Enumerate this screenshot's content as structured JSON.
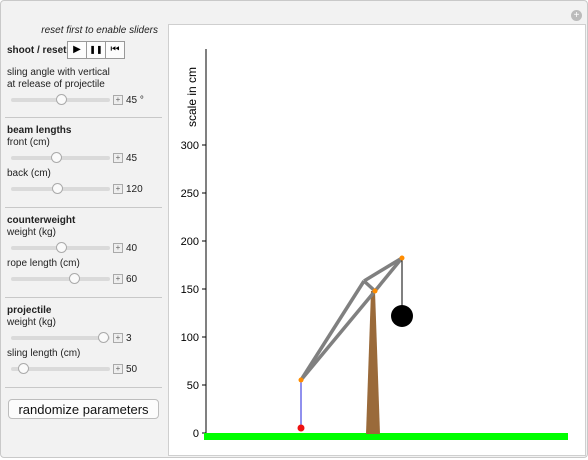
{
  "hint": "reset first to enable sliders",
  "controls": {
    "label": "shoot / reset",
    "play_glyph": "▶",
    "pause_glyph": "❚❚",
    "reset_glyph": "⏮"
  },
  "sling_angle": {
    "label_line1": "sling angle with vertical",
    "label_line2": "at release of projectile",
    "value": "45 °",
    "fraction": 0.5
  },
  "beam": {
    "heading": "beam lengths",
    "front": {
      "label": "front (cm)",
      "value": "45",
      "fraction": 0.45
    },
    "back": {
      "label": "back (cm)",
      "value": "120",
      "fraction": 0.46
    }
  },
  "counterweight": {
    "heading": "counterweight",
    "weight": {
      "label": "weight (kg)",
      "value": "40",
      "fraction": 0.5
    },
    "rope": {
      "label": "rope length (cm)",
      "value": "60",
      "fraction": 0.64
    }
  },
  "projectile": {
    "heading": "projectile",
    "weight": {
      "label": "weight (kg)",
      "value": "3",
      "fraction": 0.93
    },
    "sling": {
      "label": "sling length (cm)",
      "value": "50",
      "fraction": 0.12
    }
  },
  "randomize_label": "randomize parameters",
  "plot": {
    "ylabel": "scale in cm",
    "yticks": [
      "0",
      "50",
      "100",
      "150",
      "200",
      "250",
      "300"
    ],
    "colors": {
      "ground": "#00ff00",
      "beam": "#808080",
      "post": "#9a6a3a",
      "pivot": "#ff8c00",
      "projectile": "#ee1111",
      "sling": "#2222dd",
      "counterweight": "#000000"
    }
  }
}
